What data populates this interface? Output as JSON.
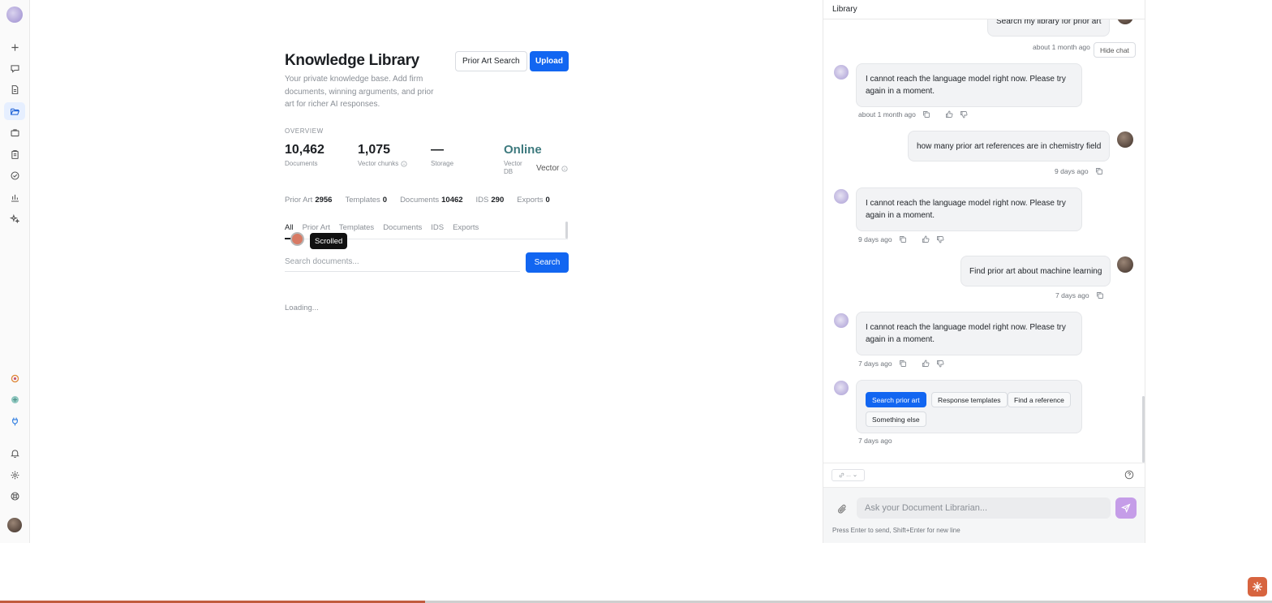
{
  "main": {
    "title": "Knowledge Library",
    "subtitle": "Your private knowledge base. Add firm documents, winning arguments, and prior art for richer AI responses.",
    "prior_art_search_label": "Prior Art Search",
    "upload_label": "Upload",
    "overview_label": "OVERVIEW",
    "stats": [
      {
        "value": "10,462",
        "label": "Documents"
      },
      {
        "value": "1,075",
        "label": "Vector chunks"
      },
      {
        "value": "—",
        "label": "Storage"
      },
      {
        "value": "Online",
        "label": "Vector DB"
      }
    ],
    "vector_label": "Vector",
    "counts": [
      {
        "label": "Prior Art",
        "value": "2956"
      },
      {
        "label": "Templates",
        "value": "0"
      },
      {
        "label": "Documents",
        "value": "10462"
      },
      {
        "label": "IDS",
        "value": "290"
      },
      {
        "label": "Exports",
        "value": "0"
      }
    ],
    "tabs": [
      "All",
      "Prior Art",
      "Templates",
      "Documents",
      "IDS",
      "Exports"
    ],
    "tooltip": "Scrolled",
    "search_placeholder": "Search documents...",
    "search_label": "Search",
    "loading": "Loading..."
  },
  "chat": {
    "title": "Library",
    "hide_chat_label": "Hide chat",
    "messages": [
      {
        "role": "user",
        "text": "Search my library for prior art",
        "time": "about 1 month ago"
      },
      {
        "role": "assistant",
        "text": "I cannot reach the language model right now. Please try again in a moment.",
        "time": "about 1 month ago"
      },
      {
        "role": "user",
        "text": "how many prior art references are in chemistry field",
        "time": "9 days ago"
      },
      {
        "role": "assistant",
        "text": "I cannot reach the language model right now. Please try again in a moment.",
        "time": "9 days ago"
      },
      {
        "role": "user",
        "text": "Find prior art about machine learning",
        "time": "7 days ago"
      },
      {
        "role": "assistant",
        "text": "I cannot reach the language model right now. Please try again in a moment.",
        "time": "7 days ago"
      }
    ],
    "choices": [
      "Search prior art",
      "Response templates",
      "Find a reference",
      "Something else"
    ],
    "choices_time": "7 days ago",
    "model_pill": "...",
    "input_placeholder": "Ask your Document Librarian...",
    "hint": "Press Enter to send, Shift+Enter for new line"
  },
  "progress": {
    "fraction": 0.334
  },
  "colors": {
    "accent": "#1266f1",
    "online": "#3e7a7e",
    "send": "#c59de8",
    "badge": "#d7643f"
  }
}
